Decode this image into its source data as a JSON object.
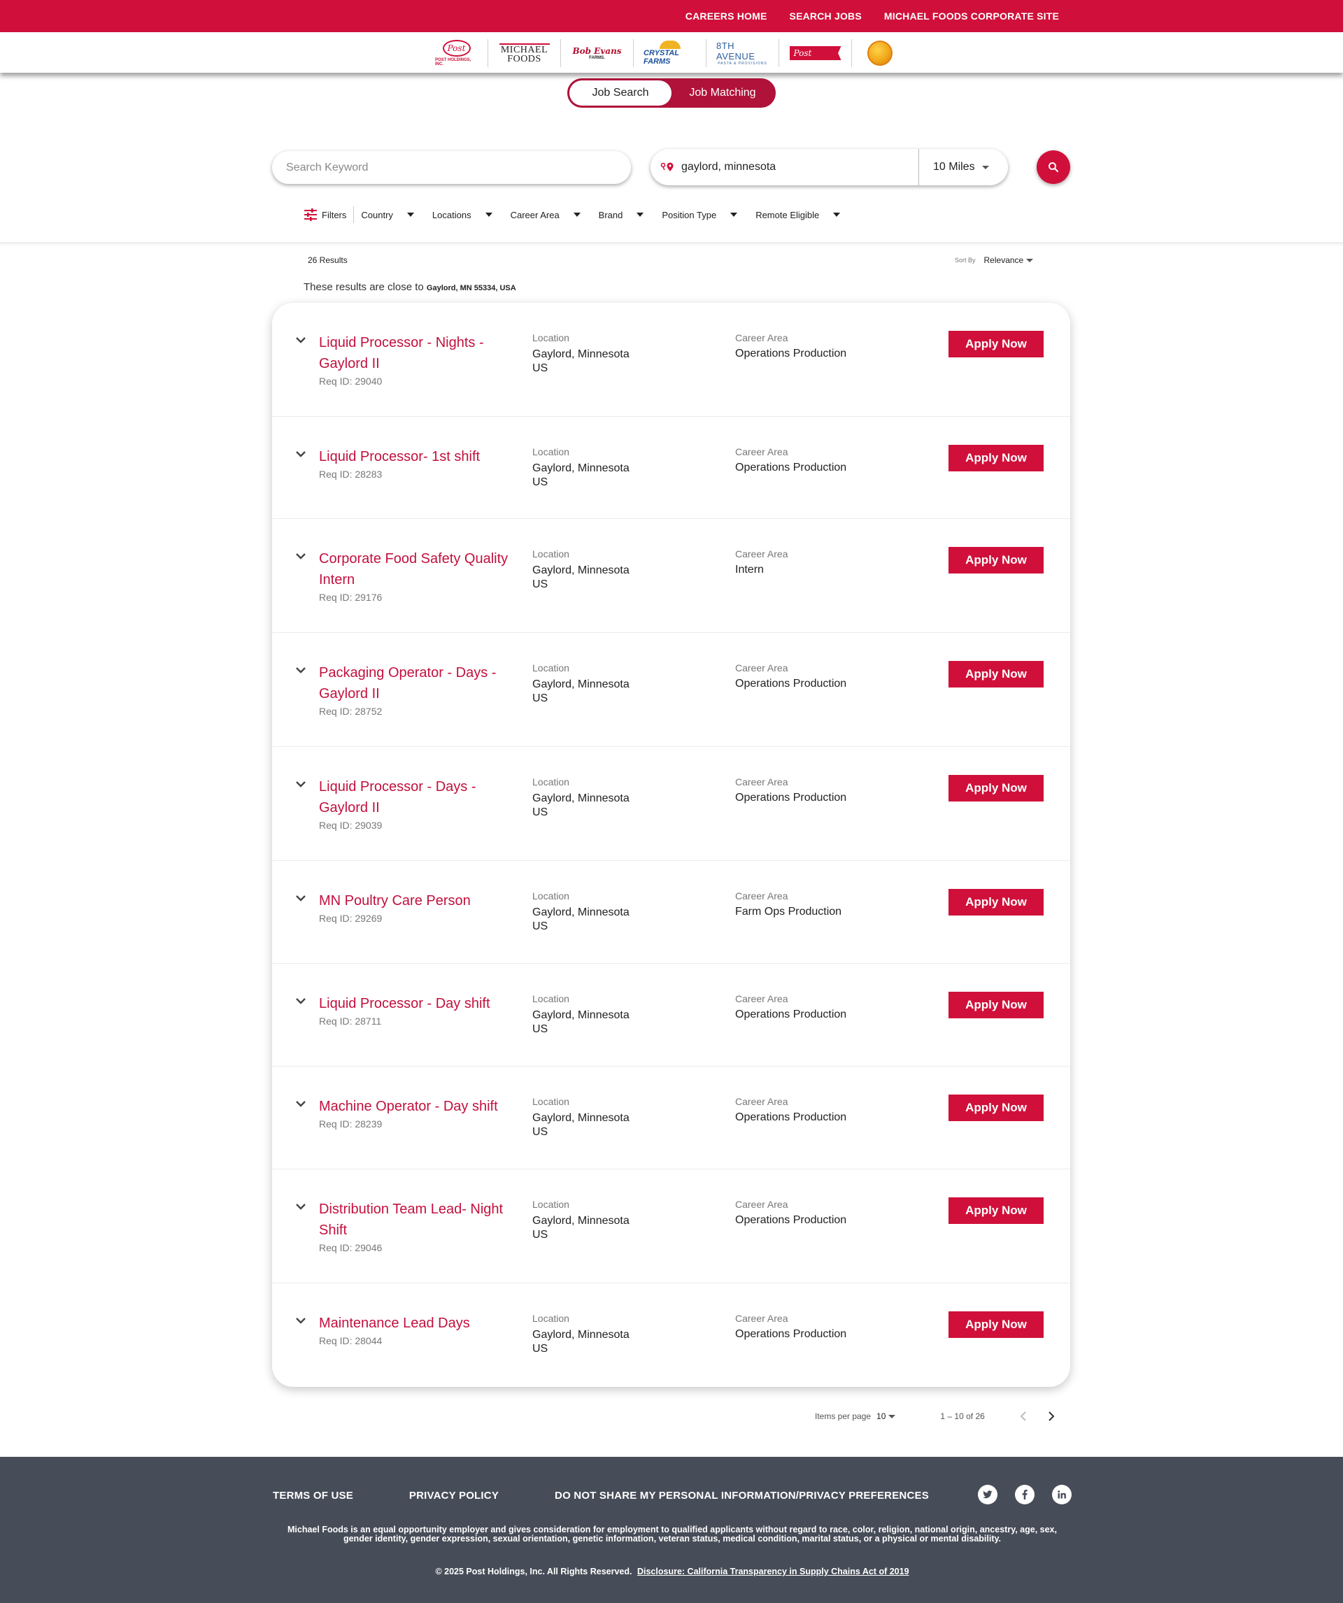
{
  "topnav": {
    "careers_home": "CAREERS HOME",
    "search_jobs": "SEARCH JOBS",
    "corporate_site": "MICHAEL FOODS CORPORATE SITE"
  },
  "brands": {
    "post_logo": "Post",
    "post_holdings": "POST HOLDINGS, INC.",
    "michael_foods_1": "MICHAEL",
    "michael_foods_2": "FOODS",
    "bob_evans": "Bob Evans",
    "bob_evans_sub": "FARMS.",
    "crystal_farms": "CRYSTAL FARMS",
    "eighth_avenue": "8TH AVENUE",
    "eighth_avenue_sub": "PASTA & PROVISIONS",
    "post_consumer": "Post"
  },
  "toggle": {
    "job_search": "Job Search",
    "job_matching": "Job Matching"
  },
  "search": {
    "keyword_placeholder": "Search Keyword",
    "location_value": "gaylord, minnesota",
    "radius": "10 Miles"
  },
  "filters": {
    "label": "Filters",
    "items": [
      "Country",
      "Locations",
      "Career Area",
      "Brand",
      "Position Type",
      "Remote Eligible"
    ]
  },
  "results": {
    "count": "26 Results",
    "sort_label": "Sort By",
    "sort_value": "Relevance",
    "close_to_prefix": "These results are close to",
    "close_to_place": "Gaylord, MN 55334, USA"
  },
  "labels": {
    "location": "Location",
    "career_area": "Career Area",
    "apply": "Apply Now"
  },
  "jobs": [
    {
      "title": "Liquid Processor - Nights - Gaylord II",
      "req": "Req ID: 29040",
      "location_1": "Gaylord, Minnesota",
      "location_2": "US",
      "career_area": "Operations Production"
    },
    {
      "title": "Liquid Processor- 1st shift",
      "req": "Req ID: 28283",
      "location_1": "Gaylord, Minnesota",
      "location_2": "US",
      "career_area": "Operations Production"
    },
    {
      "title": "Corporate Food Safety Quality Intern",
      "req": "Req ID: 29176",
      "location_1": "Gaylord, Minnesota",
      "location_2": "US",
      "career_area": "Intern"
    },
    {
      "title": "Packaging Operator - Days - Gaylord II",
      "req": "Req ID: 28752",
      "location_1": "Gaylord, Minnesota",
      "location_2": "US",
      "career_area": "Operations Production"
    },
    {
      "title": "Liquid Processor - Days - Gaylord II",
      "req": "Req ID: 29039",
      "location_1": "Gaylord, Minnesota",
      "location_2": "US",
      "career_area": "Operations Production"
    },
    {
      "title": "MN Poultry Care Person",
      "req": "Req ID: 29269",
      "location_1": "Gaylord, Minnesota",
      "location_2": "US",
      "career_area": "Farm Ops Production"
    },
    {
      "title": "Liquid Processor - Day shift",
      "req": "Req ID: 28711",
      "location_1": "Gaylord, Minnesota",
      "location_2": "US",
      "career_area": "Operations Production"
    },
    {
      "title": "Machine Operator - Day shift",
      "req": "Req ID: 28239",
      "location_1": "Gaylord, Minnesota",
      "location_2": "US",
      "career_area": "Operations Production"
    },
    {
      "title": "Distribution Team Lead- Night Shift",
      "req": "Req ID: 29046",
      "location_1": "Gaylord, Minnesota",
      "location_2": "US",
      "career_area": "Operations Production"
    },
    {
      "title": "Maintenance Lead Days",
      "req": "Req ID: 28044",
      "location_1": "Gaylord, Minnesota",
      "location_2": "US",
      "career_area": "Operations Production"
    }
  ],
  "pagination": {
    "items_per_page_label": "Items per page",
    "items_per_page": "10",
    "range": "1 – 10 of 26"
  },
  "footer": {
    "terms": "TERMS OF USE",
    "privacy": "PRIVACY POLICY",
    "do_not_share": "DO NOT SHARE MY PERSONAL INFORMATION/PRIVACY PREFERENCES",
    "eeo": "Michael Foods is an equal opportunity employer and gives consideration for employment to qualified applicants without regard to race, color, religion, national origin, ancestry, age, sex, gender identity, gender expression, sexual orientation, genetic information, veteran status, medical condition, marital status, or a physical or mental disability.",
    "copyright": "© 2025 Post Holdings, Inc. All Rights Reserved.",
    "disclosure": "Disclosure: California Transparency in Supply Chains Act of 2019"
  },
  "colors": {
    "brand_red": "#d0103a",
    "title_red": "#c2103d",
    "toggle_red": "#b0123a",
    "footer_bg": "#474d58"
  }
}
